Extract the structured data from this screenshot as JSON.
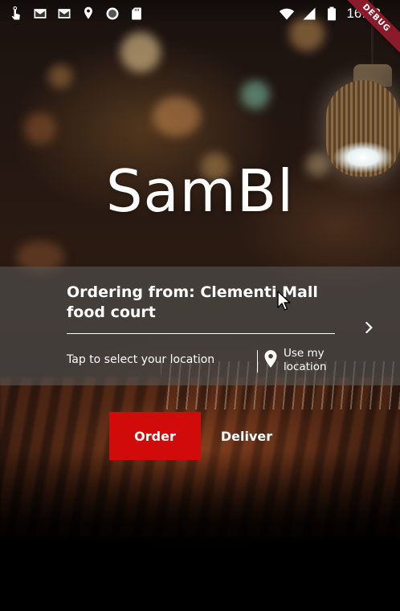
{
  "status_bar": {
    "time": "16:32",
    "left_icons": [
      "touch-app-icon",
      "gmail-icon",
      "gmail-icon",
      "location-pin-icon",
      "record-icon",
      "sd-card-icon"
    ],
    "right_icons": [
      "wifi-icon",
      "signal-icon",
      "battery-icon"
    ]
  },
  "debug_banner": "DEBUG",
  "app": {
    "title": "SamBl"
  },
  "location": {
    "ordering_from": "Ordering from:  Clementi Mall food court",
    "tap_hint": "Tap to select your location",
    "use_my_location": "Use my location",
    "chevron_icon": "chevron-right-icon",
    "pin_icon": "location-pin-icon"
  },
  "actions": {
    "order_label": "Order",
    "deliver_label": "Deliver"
  },
  "colors": {
    "accent_red": "#d10a0a",
    "panel_overlay": "rgba(90,90,90,0.58)",
    "debug_ribbon": "#8b1a2a"
  }
}
